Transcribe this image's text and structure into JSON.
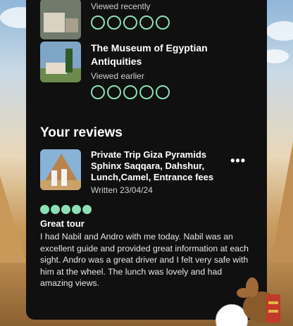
{
  "recently_viewed": [
    {
      "title": "",
      "status": "Viewed recently",
      "bubbles_filled": 0,
      "bubbles_total": 5
    },
    {
      "title": "The Museum of Egyptian Antiquities",
      "status": "Viewed earlier",
      "bubbles_filled": 0,
      "bubbles_total": 5
    }
  ],
  "reviews_section": {
    "title": "Your reviews",
    "more_label": "•••",
    "review": {
      "tour_title": "Private Trip Giza Pyramids Sphinx Saqqara, Dahshur, Lunch,Camel, Entrance fees",
      "written": "Written 23/04/24",
      "rating": 5,
      "headline": "Great tour",
      "body": "I had Nabil and Andro with me today. Nabil was an excellent guide and provided great information at each sight. Andro was a great driver and I felt very safe with him at the wheel. The lunch was lovely and had amazing views."
    }
  },
  "colors": {
    "panel": "#101010",
    "accent": "#8ce0b6"
  }
}
